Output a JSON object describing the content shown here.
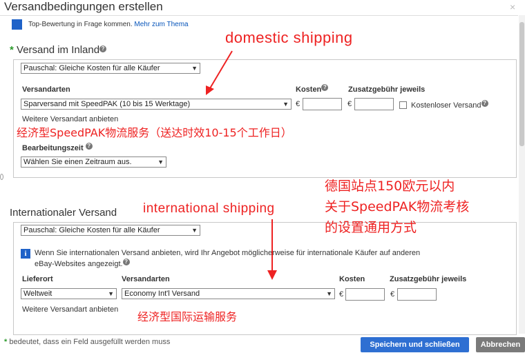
{
  "dialog": {
    "title": "Versandbedingungen erstellen",
    "top_notice": "Top-Bewertung in Frage kommen.",
    "top_link": "Mehr zum Thema"
  },
  "domestic": {
    "title": "Versand im Inland",
    "star": "*",
    "type_select": "Pauschal: Gleiche Kosten für alle Käufer",
    "versandarten_label": "Versandarten",
    "service_select": "Sparversand mit SpeedPAK (10 bis 15 Werktage)",
    "kosten_label": "Kosten",
    "zusatz_label": "Zusatzgebühr jeweils",
    "currency": "€",
    "free_shipping_label": "Kostenloser Versand",
    "more_link": "Weitere Versandart anbieten",
    "bearbeitungszeit_label": "Bearbeitungszeit",
    "bearbeitungszeit_select": "Wählen Sie einen Zeitraum aus."
  },
  "international": {
    "title": "Internationaler Versand",
    "type_select": "Pauschal: Gleiche Kosten für alle Käufer",
    "info_text_1": "Wenn Sie internationalen Versand anbieten, wird Ihr Angebot möglicherweise für internationale Käufer auf anderen",
    "info_text_2": "eBay-Websites angezeigt.",
    "lieferort_label": "Lieferort",
    "versandarten_label": "Versandarten",
    "kosten_label": "Kosten",
    "zusatz_label": "Zusatzgebühr jeweils",
    "lieferort_select": "Weltweit",
    "service_select": "Economy Int'l Versand",
    "currency": "€",
    "more_link": "Weitere Versandart anbieten"
  },
  "annotations": {
    "domestic_en": "domestic shipping",
    "domestic_cn": "经济型SpeedPAK物流服务（送达时效10-15个工作日）",
    "note_line_1": "德国站点150欧元以内",
    "note_line_2": "关于SpeedPAK物流考核",
    "note_line_3": "的设置通用方式",
    "intl_en": "international shipping",
    "intl_cn": "经济型国际运输服务"
  },
  "footer": {
    "star": "*",
    "note": "bedeutet, dass ein Feld ausgefüllt werden muss",
    "save_label": "Speichern und schließen",
    "cancel_label": "Abbrechen"
  },
  "icons": {
    "help": "?",
    "info": "i",
    "chevron": "▼",
    "close": "×"
  },
  "colors": {
    "annotation_red": "#ee2222",
    "link_blue": "#0654ba",
    "primary_button": "#2e6fd2",
    "secondary_button": "#7a7a7a",
    "required_green": "#2b9a2b"
  }
}
